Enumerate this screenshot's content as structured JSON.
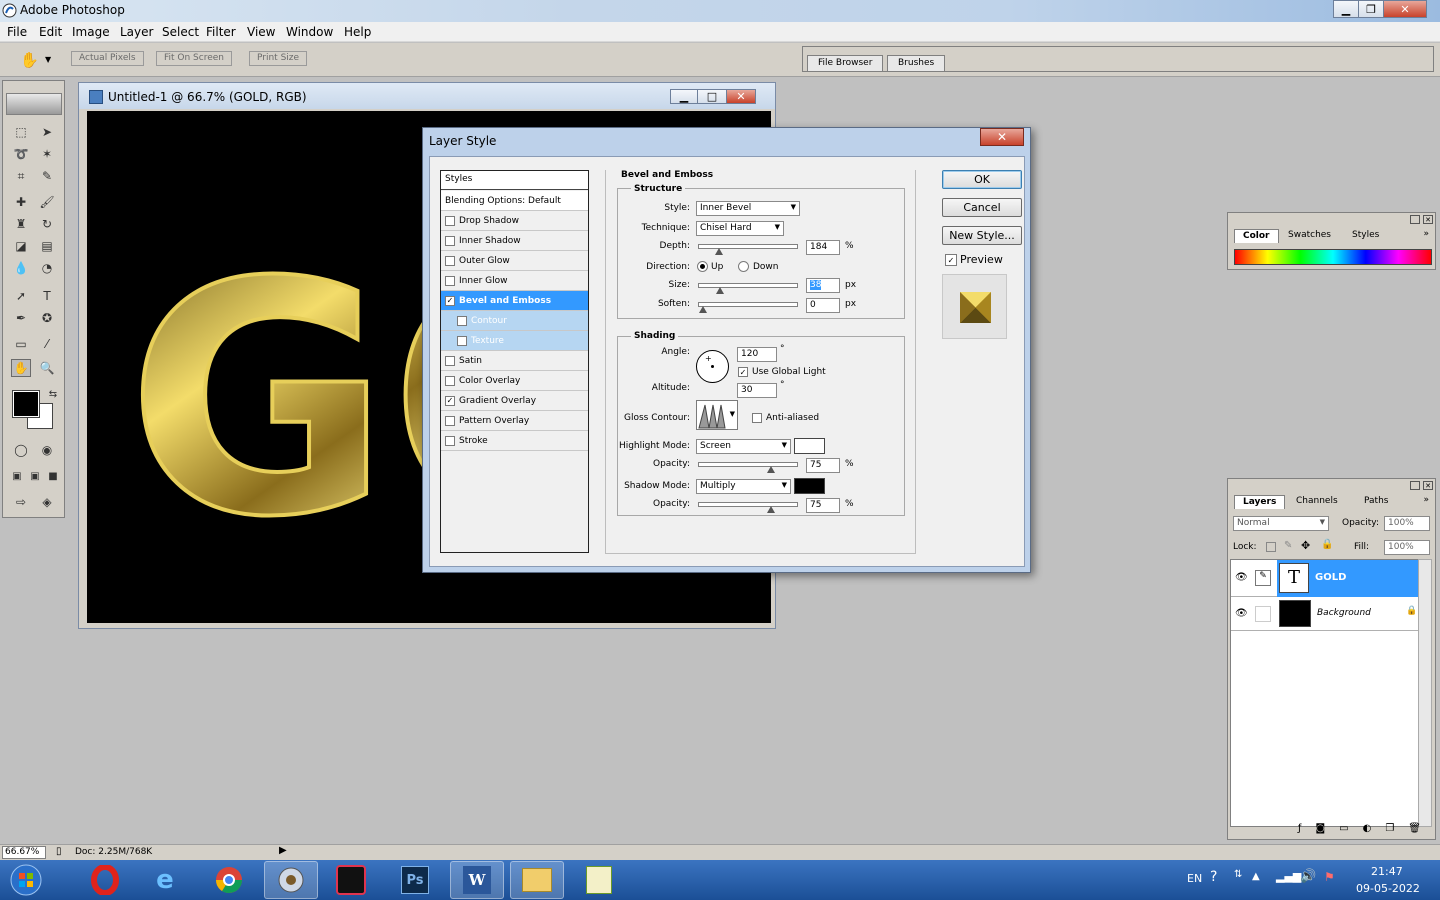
{
  "app": {
    "title": "Adobe Photoshop"
  },
  "menu": [
    "File",
    "Edit",
    "Image",
    "Layer",
    "Select",
    "Filter",
    "View",
    "Window",
    "Help"
  ],
  "options": {
    "buttons": [
      "Actual Pixels",
      "Fit On Screen",
      "Print Size"
    ]
  },
  "palette_well": {
    "tabs": [
      "File Browser",
      "Brushes"
    ]
  },
  "document": {
    "title": "Untitled-1 @ 66.7% (GOLD, RGB)",
    "text": "GO"
  },
  "dialog": {
    "title": "Layer Style",
    "styles_header": "Styles",
    "blending": "Blending Options: Default",
    "items": [
      {
        "label": "Drop Shadow",
        "checked": false,
        "state": "normal"
      },
      {
        "label": "Inner Shadow",
        "checked": false,
        "state": "normal"
      },
      {
        "label": "Outer Glow",
        "checked": false,
        "state": "normal"
      },
      {
        "label": "Inner Glow",
        "checked": false,
        "state": "normal"
      },
      {
        "label": "Bevel and Emboss",
        "checked": true,
        "state": "selected"
      },
      {
        "label": "Contour",
        "checked": false,
        "state": "sub"
      },
      {
        "label": "Texture",
        "checked": false,
        "state": "sub"
      },
      {
        "label": "Satin",
        "checked": false,
        "state": "normal"
      },
      {
        "label": "Color Overlay",
        "checked": false,
        "state": "normal"
      },
      {
        "label": "Gradient Overlay",
        "checked": true,
        "state": "normal"
      },
      {
        "label": "Pattern Overlay",
        "checked": false,
        "state": "normal"
      },
      {
        "label": "Stroke",
        "checked": false,
        "state": "normal"
      }
    ],
    "section_title": "Bevel and Emboss",
    "structure": {
      "title": "Structure",
      "style_label": "Style:",
      "style_value": "Inner Bevel",
      "technique_label": "Technique:",
      "technique_value": "Chisel Hard",
      "depth_label": "Depth:",
      "depth_value": "184",
      "depth_unit": "%",
      "depth_level": 0.18,
      "direction_label": "Direction:",
      "dir_up": "Up",
      "dir_down": "Down",
      "size_label": "Size:",
      "size_value": "38",
      "size_unit": "px",
      "size_level": 0.19,
      "soften_label": "Soften:",
      "soften_value": "0",
      "soften_unit": "px",
      "soften_level": 0
    },
    "shading": {
      "title": "Shading",
      "angle_label": "Angle:",
      "angle_value": "120",
      "angle_unit": "°",
      "global_light": "Use Global Light",
      "altitude_label": "Altitude:",
      "altitude_value": "30",
      "altitude_unit": "°",
      "gloss_label": "Gloss Contour:",
      "anti_aliased": "Anti-aliased",
      "highlight_label": "Highlight Mode:",
      "highlight_value": "Screen",
      "opacity_label": "Opacity:",
      "hl_opacity": "75",
      "hl_level": 0.75,
      "shadow_label": "Shadow Mode:",
      "shadow_value": "Multiply",
      "sh_opacity": "75",
      "sh_level": 0.75,
      "pct": "%"
    },
    "buttons": {
      "ok": "OK",
      "cancel": "Cancel",
      "new_style": "New Style...",
      "preview": "Preview"
    }
  },
  "color_panel": {
    "tabs": [
      "Color",
      "Swatches",
      "Styles"
    ]
  },
  "layers_panel": {
    "tabs": [
      "Layers",
      "Channels",
      "Paths"
    ],
    "blend": "Normal",
    "opacity_label": "Opacity:",
    "opacity": "100%",
    "lock_label": "Lock:",
    "fill_label": "Fill:",
    "fill": "100%",
    "layers": [
      {
        "name": "GOLD",
        "selected": true
      },
      {
        "name": "Background",
        "selected": false
      }
    ]
  },
  "status": {
    "zoom": "66.67%",
    "doc": "Doc: 2.25M/768K"
  },
  "taskbar": {
    "lang": "EN",
    "time": "21:47",
    "date": "09-05-2022"
  },
  "colors": {
    "accent": "#3399ff",
    "gold": "#c9a227",
    "taskbar": "#1b4f96"
  }
}
